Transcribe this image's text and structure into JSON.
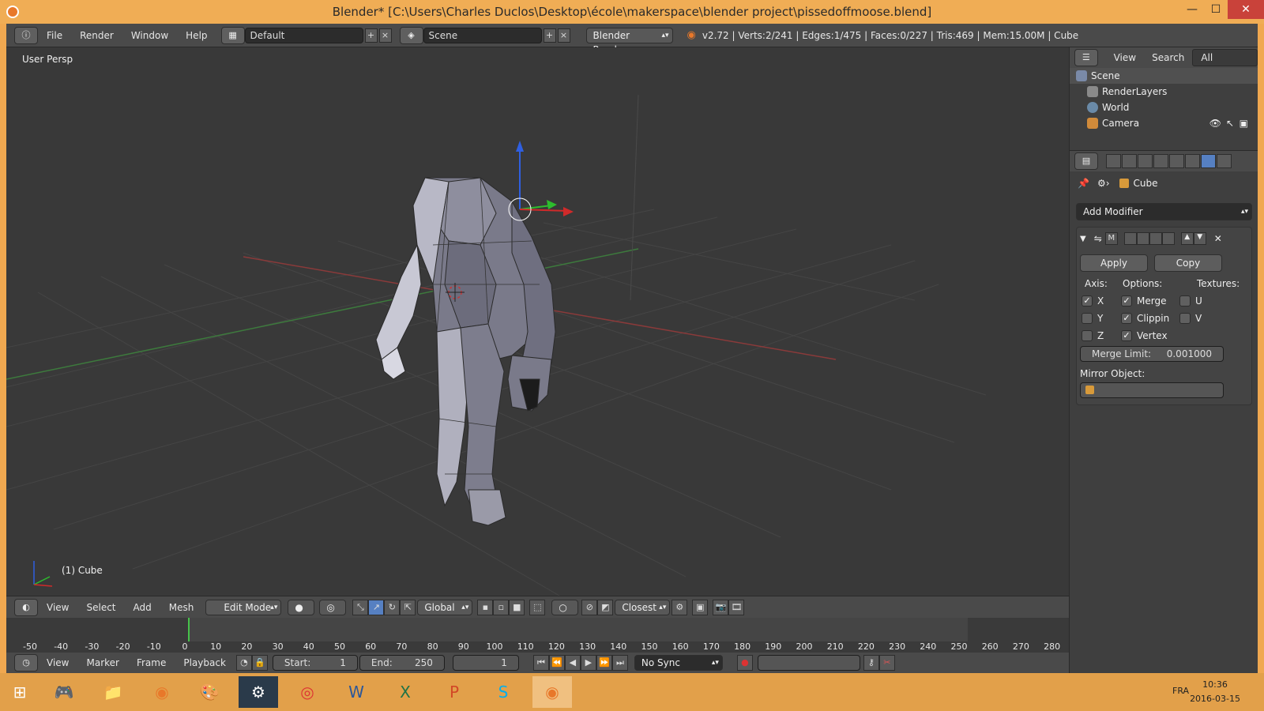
{
  "window": {
    "title": "Blender* [C:\\Users\\Charles Duclos\\Desktop\\école\\makerspace\\blender project\\pissedoffmoose.blend]",
    "minimize": "—",
    "maximize": "☐",
    "close": "✕"
  },
  "topbar": {
    "menus": [
      "File",
      "Render",
      "Window",
      "Help"
    ],
    "layout": "Default",
    "scene": "Scene",
    "engine": "Blender Render",
    "stats": "v2.72 | Verts:2/241 | Edges:1/475 | Faces:0/227 | Tris:469 | Mem:15.00M | Cube"
  },
  "viewport": {
    "view_label": "User Persp",
    "object_label": "(1) Cube"
  },
  "header3d": {
    "menus": [
      "View",
      "Select",
      "Add",
      "Mesh"
    ],
    "mode": "Edit Mode",
    "orientation": "Global",
    "snap": "Closest"
  },
  "timeline": {
    "ticks": [
      "-50",
      "-40",
      "-30",
      "-20",
      "-10",
      "0",
      "10",
      "20",
      "30",
      "40",
      "50",
      "60",
      "70",
      "80",
      "90",
      "100",
      "110",
      "120",
      "130",
      "140",
      "150",
      "160",
      "170",
      "180",
      "190",
      "200",
      "210",
      "220",
      "230",
      "240",
      "250",
      "260",
      "270",
      "280"
    ],
    "current_frame": 1
  },
  "tlheader": {
    "menus": [
      "View",
      "Marker",
      "Frame",
      "Playback"
    ],
    "start": "Start:",
    "start_val": "1",
    "end": "End:",
    "end_val": "250",
    "frame_val": "1",
    "sync": "No Sync"
  },
  "outliner": {
    "tabs": [
      "View",
      "Search",
      "All Scenes"
    ],
    "rows": [
      "Scene",
      "RenderLayers",
      "World",
      "Camera"
    ]
  },
  "properties": {
    "object": "Cube",
    "add_modifier": "Add Modifier",
    "modifier_short": "M",
    "apply": "Apply",
    "copy": "Copy",
    "axis_label": "Axis:",
    "options_label": "Options:",
    "textures_label": "Textures:",
    "axis": [
      "X",
      "Y",
      "Z"
    ],
    "axis_checked": [
      true,
      false,
      false
    ],
    "options": [
      "Merge",
      "Clippin",
      "Vertex"
    ],
    "options_checked": [
      true,
      true,
      true
    ],
    "textures": [
      "U",
      "V"
    ],
    "merge_limit_label": "Merge Limit:",
    "merge_limit_value": "0.001000",
    "mirror_object_label": "Mirror Object:"
  },
  "taskbar": {
    "lang": "FRA",
    "time": "10:36",
    "date": "2016-03-15"
  }
}
